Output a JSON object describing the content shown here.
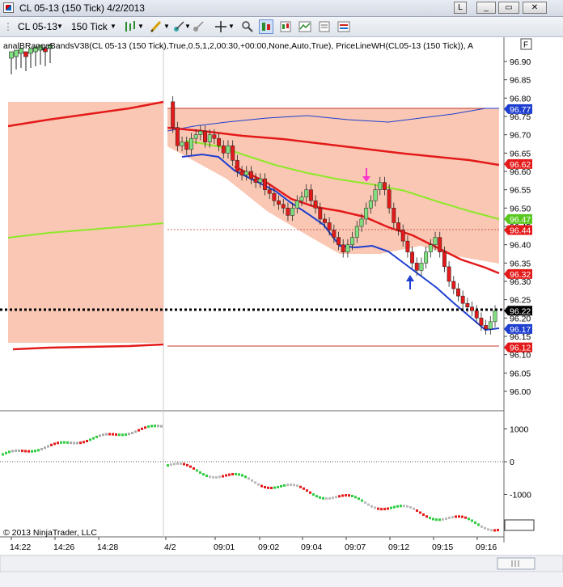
{
  "window": {
    "title": "CL 05-13 (150 Tick)  4/2/2013",
    "min": "L",
    "restore": "□",
    "max": "□",
    "close": "✕"
  },
  "toolbar": {
    "instrument": "CL 05-13",
    "interval": "150 Tick"
  },
  "indicator_label": "analBRangeBandsV38(CL 05-13 (150 Tick),True,0.5,1,2,00:30,+00:00,None,Auto,True), PriceLineWH(CL05-13 (150 Tick)), A",
  "f_button": "F",
  "copyright": "© 2013 NinjaTrader, LLC",
  "price_axis": [
    "96.90",
    "96.85",
    "96.80",
    "96.75",
    "96.70",
    "96.65",
    "96.60",
    "96.55",
    "96.50",
    "96.45",
    "96.40",
    "96.35",
    "96.30",
    "96.25",
    "96.20",
    "96.15",
    "96.10",
    "96.05",
    "96.00"
  ],
  "price_tags": [
    {
      "label": "96.77",
      "color": "#1f3fd0"
    },
    {
      "label": "96.62",
      "color": "#e41a1a"
    },
    {
      "label": "96.47",
      "color": "#58c81e"
    },
    {
      "label": "96.44",
      "color": "#e41a1a"
    },
    {
      "label": "96.32",
      "color": "#e41a1a"
    },
    {
      "label": "96.22",
      "color": "#000000"
    },
    {
      "label": "96.17",
      "color": "#1f3fd0"
    },
    {
      "label": "96.12",
      "color": "#e41a1a"
    }
  ],
  "lower_axis": [
    "1000",
    "0",
    "-1000",
    "-2000"
  ],
  "time_axis": [
    "14:22",
    "14:26",
    "14:28",
    "4/2",
    "09:01",
    "09:02",
    "09:04",
    "09:07",
    "09:12",
    "09:15",
    "09:16"
  ],
  "colors": {
    "band_fill": "#f9c7b3",
    "upper_red": "#e41a1a",
    "green": "#8ee82a",
    "blue": "#1f3fd0",
    "up_candle": "#7fe07f",
    "down_candle": "#e41a1a"
  },
  "chart_data": {
    "type": "candlestick",
    "y_range": [
      95.98,
      96.93
    ],
    "lower_panel_range": [
      -2000,
      1200
    ],
    "x_categories": [
      "14:22",
      "14:26",
      "14:28",
      "4/2",
      "09:01",
      "09:02",
      "09:04",
      "09:07",
      "09:12",
      "09:15",
      "09:16"
    ],
    "last_price": 96.22
  }
}
